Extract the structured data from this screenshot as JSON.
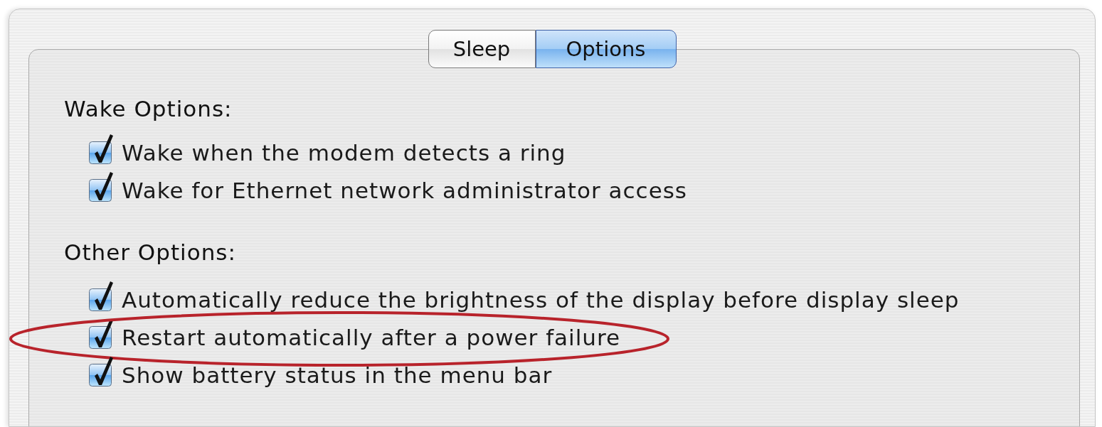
{
  "tabs": [
    {
      "label": "Sleep",
      "selected": false
    },
    {
      "label": "Options",
      "selected": true
    }
  ],
  "sections": [
    {
      "heading": "Wake Options:",
      "options": [
        {
          "label": "Wake when the modem detects a ring",
          "checked": true,
          "circled": false
        },
        {
          "label": "Wake for Ethernet network administrator access",
          "checked": true,
          "circled": false
        }
      ]
    },
    {
      "heading": "Other Options:",
      "options": [
        {
          "label": "Automatically reduce the brightness of the display before display sleep",
          "checked": true,
          "circled": false
        },
        {
          "label": "Restart automatically after a power failure",
          "checked": true,
          "circled": true
        },
        {
          "label": "Show battery status in the menu bar",
          "checked": true,
          "circled": false
        }
      ]
    }
  ]
}
